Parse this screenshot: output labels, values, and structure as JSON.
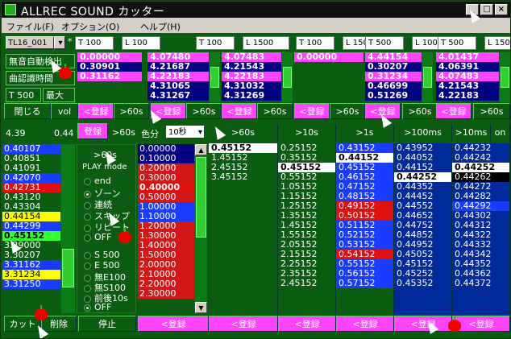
{
  "title": "ALLREC SOUND カッター",
  "menu": [
    "ファイル(F)",
    "オプション(O)",
    "ヘルプ(H)"
  ],
  "toolbar": {
    "track_select": "TL16_001",
    "star": "*",
    "t_vals": [
      "T 100",
      "L 100",
      "T 100",
      "L 1500",
      "T 100",
      "L 1500",
      "T 500",
      "L 100",
      "T 500",
      "L 1500"
    ]
  },
  "left_buttons": [
    "無音自動検出",
    "曲認識時間",
    "T 500",
    "最大",
    "閉じる",
    "vol"
  ],
  "register": "<登録",
  "register_top": "登録",
  "s60": ">60s",
  "top_panes": [
    {
      "rows": [
        "0.00000",
        "0.30901",
        "0.31162"
      ],
      "colors": [
        "mag",
        "nav",
        "mag"
      ]
    },
    {
      "rows": [
        "4.07480",
        "4.21687",
        "4.22183",
        "4.31065",
        "4.31267"
      ],
      "colors": [
        "mag",
        "nav",
        "mag",
        "nav",
        "nav"
      ]
    },
    {
      "rows": [
        "4.07483",
        "4.21543",
        "4.22183",
        "4.31032",
        "4.31269"
      ],
      "colors": [
        "mag",
        "nav",
        "mag",
        "nav",
        "nav"
      ]
    },
    {
      "rows": [
        "0.00000"
      ],
      "colors": [
        "mag"
      ]
    },
    {
      "rows": [
        "4.44154",
        "0.30207",
        "0.31234",
        "0.46699",
        "0.51269"
      ],
      "colors": [
        "mag",
        "nav",
        "mag",
        "nav",
        "nav"
      ]
    },
    {
      "rows": [
        "4.01437",
        "4.06391",
        "4.07483",
        "4.21543",
        "4.22183"
      ],
      "colors": [
        "mag",
        "nav",
        "mag",
        "nav",
        "nav"
      ]
    }
  ],
  "mid": {
    "left_time": "4.39",
    "right_time": "0.44",
    "color_label": "色分",
    "seconds_select": "10秒"
  },
  "play_mode": {
    "label": "PLAY mode",
    "items": [
      "end",
      "ゾーン",
      "連続",
      "スキップ",
      "リピート",
      "OFF"
    ],
    "lower": [
      "S 500",
      "E 500",
      "無E100",
      "無S100",
      "前後10s",
      "OFF"
    ]
  },
  "gt60": ">60s",
  "left_list": [
    {
      "v": "0.40107",
      "c": "blu"
    },
    {
      "v": "0.40851",
      "c": "grn"
    },
    {
      "v": "0.41091",
      "c": "grn"
    },
    {
      "v": "0.42070",
      "c": "blu"
    },
    {
      "v": "0.42731",
      "c": "red"
    },
    {
      "v": "0.43120",
      "c": "grn"
    },
    {
      "v": "0.43304",
      "c": "grn"
    },
    {
      "v": "0.44154",
      "c": "yel"
    },
    {
      "v": "0.44299",
      "c": "blu"
    },
    {
      "v": "0.45152",
      "c": "lim"
    },
    {
      "v": "3.29000",
      "c": "grn"
    },
    {
      "v": "3.30207",
      "c": "grn"
    },
    {
      "v": "3.31162",
      "c": "blu"
    },
    {
      "v": "3.31234",
      "c": "yel"
    },
    {
      "v": "3.31250",
      "c": "blu"
    }
  ],
  "red_list": [
    "0.00000",
    "0.10000",
    "0.20000",
    "0.30000",
    "0.40000",
    "0.50000",
    "1.00000",
    "1.10000",
    "1.20000",
    "1.30000",
    "1.40000",
    "1.50000",
    "2.00000",
    "2.10000",
    "2.20000",
    "2.30000"
  ],
  "headers": [
    ">60s",
    ">10s",
    ">1s",
    ">100ms",
    ">10ms",
    "on"
  ],
  "cols": [
    {
      "items": [
        {
          "v": "0.45152",
          "c": "wht"
        },
        {
          "v": "1.45152",
          "c": ""
        },
        {
          "v": "2.45152",
          "c": ""
        },
        {
          "v": "3.45152",
          "c": ""
        }
      ]
    },
    {
      "items": [
        {
          "v": "0.25152",
          "c": ""
        },
        {
          "v": "0.35152",
          "c": ""
        },
        {
          "v": "0.45152",
          "c": "wht"
        },
        {
          "v": "0.55152",
          "c": ""
        },
        {
          "v": "1.05152",
          "c": ""
        },
        {
          "v": "1.15152",
          "c": ""
        },
        {
          "v": "1.25152",
          "c": ""
        },
        {
          "v": "1.35152",
          "c": ""
        },
        {
          "v": "1.45152",
          "c": ""
        },
        {
          "v": "1.55152",
          "c": ""
        },
        {
          "v": "2.05152",
          "c": ""
        },
        {
          "v": "2.15152",
          "c": ""
        },
        {
          "v": "2.25152",
          "c": ""
        },
        {
          "v": "2.35152",
          "c": ""
        },
        {
          "v": "2.45152",
          "c": ""
        }
      ]
    },
    {
      "items": [
        {
          "v": "0.43152",
          "c": "blu"
        },
        {
          "v": "0.44152",
          "c": "wht"
        },
        {
          "v": "0.45152",
          "c": "blu"
        },
        {
          "v": "0.46152",
          "c": "blu"
        },
        {
          "v": "0.47152",
          "c": "blu"
        },
        {
          "v": "0.48152",
          "c": "blu"
        },
        {
          "v": "0.49152",
          "c": "red"
        },
        {
          "v": "0.50152",
          "c": "red"
        },
        {
          "v": "0.51152",
          "c": "blu"
        },
        {
          "v": "0.52152",
          "c": "blu"
        },
        {
          "v": "0.53152",
          "c": "blu"
        },
        {
          "v": "0.54152",
          "c": "red"
        },
        {
          "v": "0.55152",
          "c": "blu"
        },
        {
          "v": "0.56152",
          "c": "blu"
        },
        {
          "v": "0.57152",
          "c": "blu"
        }
      ]
    },
    {
      "items": [
        {
          "v": "0.43952",
          "c": "dnv"
        },
        {
          "v": "0.44052",
          "c": "dnv"
        },
        {
          "v": "0.44152",
          "c": "dnv"
        },
        {
          "v": "0.44252",
          "c": "wht"
        },
        {
          "v": "0.44352",
          "c": "dnv"
        },
        {
          "v": "0.44452",
          "c": "dnv"
        },
        {
          "v": "0.44552",
          "c": "dnv"
        },
        {
          "v": "0.44652",
          "c": "dnv"
        },
        {
          "v": "0.44752",
          "c": "dnv"
        },
        {
          "v": "0.44852",
          "c": "dnv"
        },
        {
          "v": "0.44952",
          "c": "dnv"
        },
        {
          "v": "0.45052",
          "c": "dnv"
        },
        {
          "v": "0.45152",
          "c": "dnv"
        },
        {
          "v": "0.45252",
          "c": "dnv"
        },
        {
          "v": "0.45352",
          "c": "dnv"
        }
      ]
    },
    {
      "items": [
        {
          "v": "0.44232",
          "c": "dnv"
        },
        {
          "v": "0.44242",
          "c": "dnv"
        },
        {
          "v": "0.44252",
          "c": "wht"
        },
        {
          "v": "0.44262",
          "c": "blk"
        },
        {
          "v": "0.44272",
          "c": "dnv"
        },
        {
          "v": "0.44282",
          "c": "dnv"
        },
        {
          "v": "0.44292",
          "c": "blu"
        },
        {
          "v": "0.44302",
          "c": "dnv"
        },
        {
          "v": "0.44312",
          "c": "dnv"
        },
        {
          "v": "0.44322",
          "c": "dnv"
        },
        {
          "v": "0.44332",
          "c": "dnv"
        },
        {
          "v": "0.44342",
          "c": "dnv"
        },
        {
          "v": "0.44352",
          "c": "dnv"
        },
        {
          "v": "0.44362",
          "c": "dnv"
        },
        {
          "v": "0.44372",
          "c": "dnv"
        }
      ]
    }
  ],
  "bottom": {
    "cut": "カット",
    "del": "削除",
    "stop": "停止"
  }
}
